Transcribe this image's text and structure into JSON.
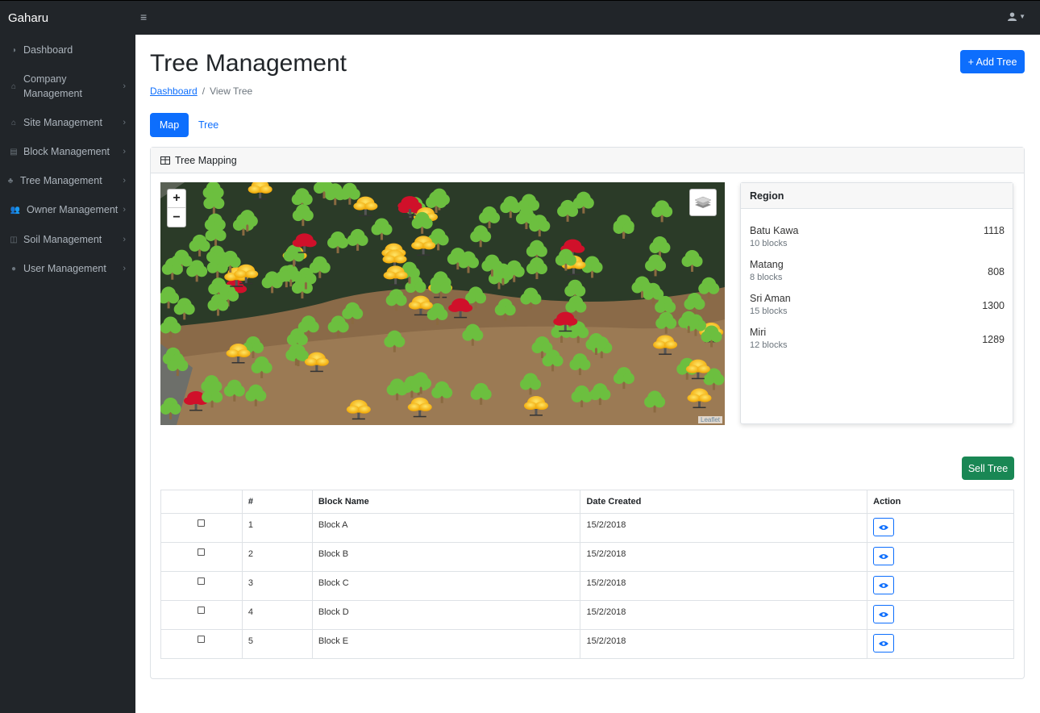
{
  "app": {
    "brand": "Gaharu"
  },
  "sidebar": {
    "items": [
      {
        "label": "Dashboard",
        "icon": "dashboard-icon",
        "has_children": false
      },
      {
        "label": "Company Management",
        "icon": "home-icon",
        "has_children": true
      },
      {
        "label": "Site Management",
        "icon": "home-icon",
        "has_children": true
      },
      {
        "label": "Block Management",
        "icon": "building-icon",
        "has_children": true
      },
      {
        "label": "Tree Management",
        "icon": "tree-icon",
        "has_children": true
      },
      {
        "label": "Owner Management",
        "icon": "users-icon",
        "has_children": true
      },
      {
        "label": "Soil Management",
        "icon": "table-icon",
        "has_children": true
      },
      {
        "label": "User Management",
        "icon": "user-icon",
        "has_children": true
      }
    ]
  },
  "header": {
    "title": "Tree Management",
    "add_button": "+ Add Tree",
    "breadcrumb": {
      "home": "Dashboard",
      "separator": "/",
      "current": "View Tree"
    }
  },
  "tabs": {
    "map": "Map",
    "tree": "Tree"
  },
  "card": {
    "title": "Tree Mapping"
  },
  "map": {
    "attribution": "Leaflet",
    "zoom_in": "+",
    "zoom_out": "−"
  },
  "region": {
    "title": "Region",
    "items": [
      {
        "name": "Batu Kawa",
        "blocks": "10 blocks",
        "count": "1118"
      },
      {
        "name": "Matang",
        "blocks": "8 blocks",
        "count": "808"
      },
      {
        "name": "Sri Aman",
        "blocks": "15 blocks",
        "count": "1300"
      },
      {
        "name": "Miri",
        "blocks": "12 blocks",
        "count": "1289"
      }
    ]
  },
  "sell_button": "Sell Tree",
  "table": {
    "columns": [
      "",
      "#",
      "Block Name",
      "Date Created",
      "Action"
    ],
    "rows": [
      {
        "num": "1",
        "name": "Block A",
        "date": "15/2/2018"
      },
      {
        "num": "2",
        "name": "Block B",
        "date": "15/2/2018"
      },
      {
        "num": "3",
        "name": "Block C",
        "date": "15/2/2018"
      },
      {
        "num": "4",
        "name": "Block D",
        "date": "15/2/2018"
      },
      {
        "num": "5",
        "name": "Block E",
        "date": "15/2/2018"
      }
    ]
  },
  "colors": {
    "primary": "#0d6efd",
    "success": "#198754",
    "sidebar_bg": "#212529",
    "tree_green": "#6cbf3f",
    "tree_yellow": "#f5b800",
    "tree_red": "#d0102a"
  }
}
